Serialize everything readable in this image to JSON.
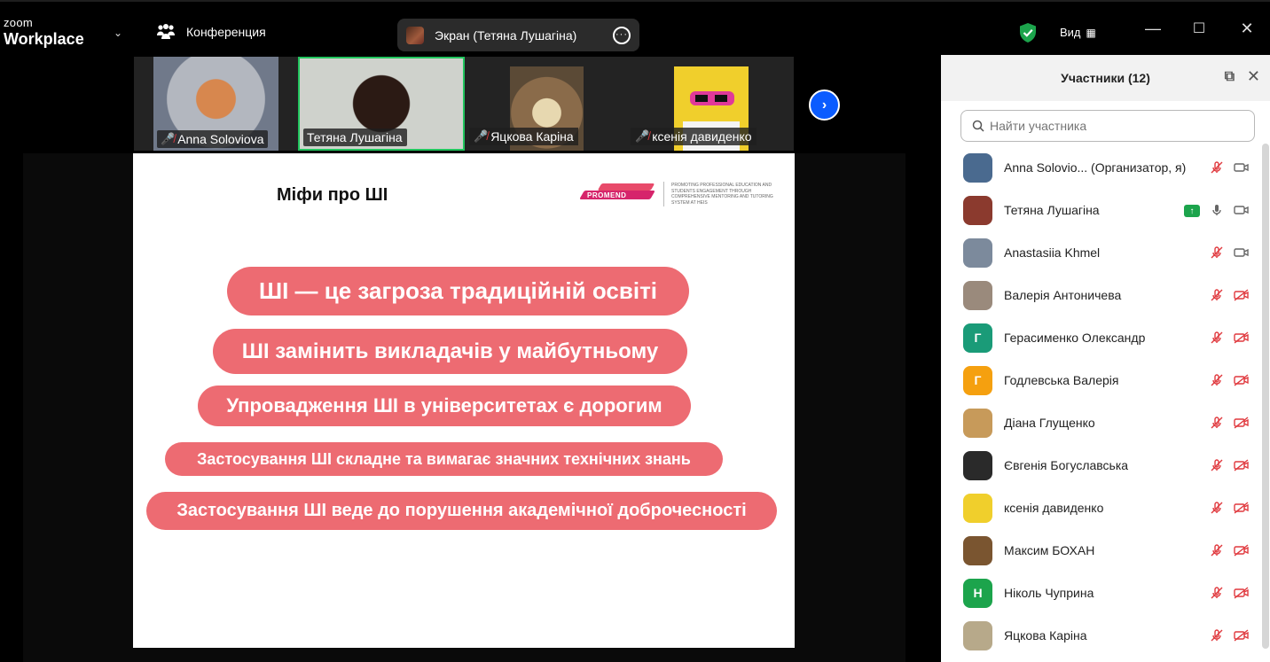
{
  "app": {
    "logo_small": "zoom",
    "logo_big": "Workplace"
  },
  "topbar": {
    "meeting_label": "Конференция",
    "screen_share_label": "Экран (Тетяна Лушагіна)",
    "view_label": "Вид",
    "security_color": "#1ca44c"
  },
  "video_strip": {
    "tiles": [
      {
        "name": "Anna Soloviova",
        "muted": true,
        "active": false
      },
      {
        "name": "Тетяна Лушагіна",
        "muted": false,
        "active": true
      },
      {
        "name": "Яцкова Каріна",
        "muted": true,
        "active": false
      },
      {
        "name": "ксенія давиденко",
        "muted": true,
        "active": false
      }
    ],
    "next_icon": "chevron-right-icon"
  },
  "slide": {
    "title": "Міфи про ШІ",
    "brand_name": "PROMEND",
    "brand_tagline": "PROMOTING PROFESSIONAL EDUCATION AND STUDENTS ENGAGEMENT THROUGH COMPREHENSIVE MENTORING AND TUTORING SYSTEM AT HEIS",
    "accent_color": "#ed6b72",
    "myths": [
      "ШІ — це загроза традиційній освіті",
      "ШІ замінить викладачів у майбутньому",
      "Упровадження ШІ в університетах є дорогим",
      "Застосування ШІ складне та вимагає значних технічних знань",
      "Застосування ШІ веде до порушення академічної доброчесності"
    ]
  },
  "participants": {
    "title": "Участники (12)",
    "search_placeholder": "Найти участника",
    "items": [
      {
        "name": "Anna Solovio... (Организатор, я)",
        "avatar_letter": "",
        "avatar_color": "#4a6a8f",
        "mic": "muted",
        "video": "on"
      },
      {
        "name": "Тетяна Лушагіна",
        "avatar_letter": "",
        "avatar_color": "#8b3a2e",
        "mic": "on",
        "video": "on",
        "sharing": true
      },
      {
        "name": "Anastasiia Khmel",
        "avatar_letter": "",
        "avatar_color": "#7c8a9c",
        "mic": "muted",
        "video": "on"
      },
      {
        "name": "Валерія Антоничева",
        "avatar_letter": "",
        "avatar_color": "#9a8a7c",
        "mic": "muted",
        "video": "off"
      },
      {
        "name": "Герасименко Олександр",
        "avatar_letter": "Г",
        "avatar_color": "#1a9b78",
        "mic": "muted",
        "video": "off"
      },
      {
        "name": "Годлевська Валерія",
        "avatar_letter": "Г",
        "avatar_color": "#f5a00f",
        "mic": "muted",
        "video": "off"
      },
      {
        "name": "Діана Глущенко",
        "avatar_letter": "",
        "avatar_color": "#c79a5a",
        "mic": "muted",
        "video": "off"
      },
      {
        "name": "Євгенія Богуславська",
        "avatar_letter": "",
        "avatar_color": "#2a2a2a",
        "mic": "muted",
        "video": "off"
      },
      {
        "name": "ксенія давиденко",
        "avatar_letter": "",
        "avatar_color": "#f0cf2c",
        "mic": "muted",
        "video": "off"
      },
      {
        "name": "Максим БОХАН",
        "avatar_letter": "",
        "avatar_color": "#7a5530",
        "mic": "muted",
        "video": "off"
      },
      {
        "name": "Ніколь Чуприна",
        "avatar_letter": "Н",
        "avatar_color": "#1ca44c",
        "mic": "muted",
        "video": "off"
      },
      {
        "name": "Яцкова Каріна",
        "avatar_letter": "",
        "avatar_color": "#b7a98a",
        "mic": "muted",
        "video": "off"
      }
    ]
  },
  "icons": {
    "mic_muted": "🎤",
    "camera": "▭"
  }
}
